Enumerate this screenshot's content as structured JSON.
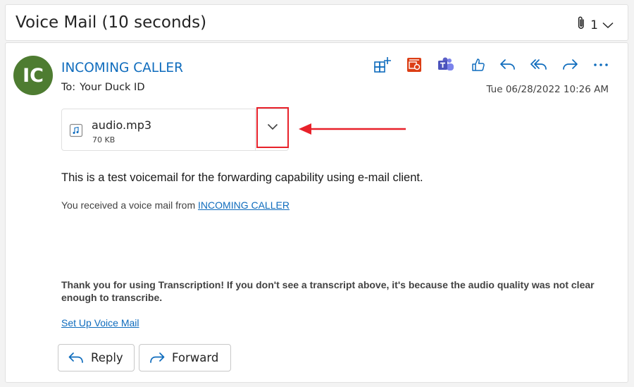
{
  "subject": {
    "title": "Voice Mail (10 seconds)",
    "attachment_count": "1",
    "icons": [
      "paperclip-icon",
      "chevron-down-icon"
    ]
  },
  "message": {
    "avatar_initials": "IC",
    "avatar_color": "#4e7c31",
    "sender": "INCOMING CALLER",
    "to_label": "To:",
    "to_value": "Your Duck ID",
    "timestamp": "Tue 06/28/2022 10:26 AM",
    "toolbar_icons": [
      "apps-add-icon",
      "office-calendar-icon",
      "teams-icon",
      "like-icon",
      "reply-icon",
      "reply-all-icon",
      "forward-icon",
      "more-icon"
    ],
    "attachment": {
      "name": "audio.mp3",
      "size": "70 KB",
      "icon": "audio-file-icon"
    },
    "body_text": "This is a test voicemail for the forwarding capability using e-mail client.",
    "received_prefix": "You received a voice mail from",
    "received_link": "INCOMING CALLER",
    "thanks_text": "Thank you for using Transcription! If you don't see a transcript above, it's because the audio quality was not clear enough to transcribe.",
    "setup_link": "Set Up Voice Mail",
    "reply_label": "Reply",
    "forward_label": "Forward"
  },
  "colors": {
    "accent": "#0f6cbd",
    "annotation": "#e8212a",
    "teams": "#5b5fc7",
    "office": "#dc3e15"
  }
}
